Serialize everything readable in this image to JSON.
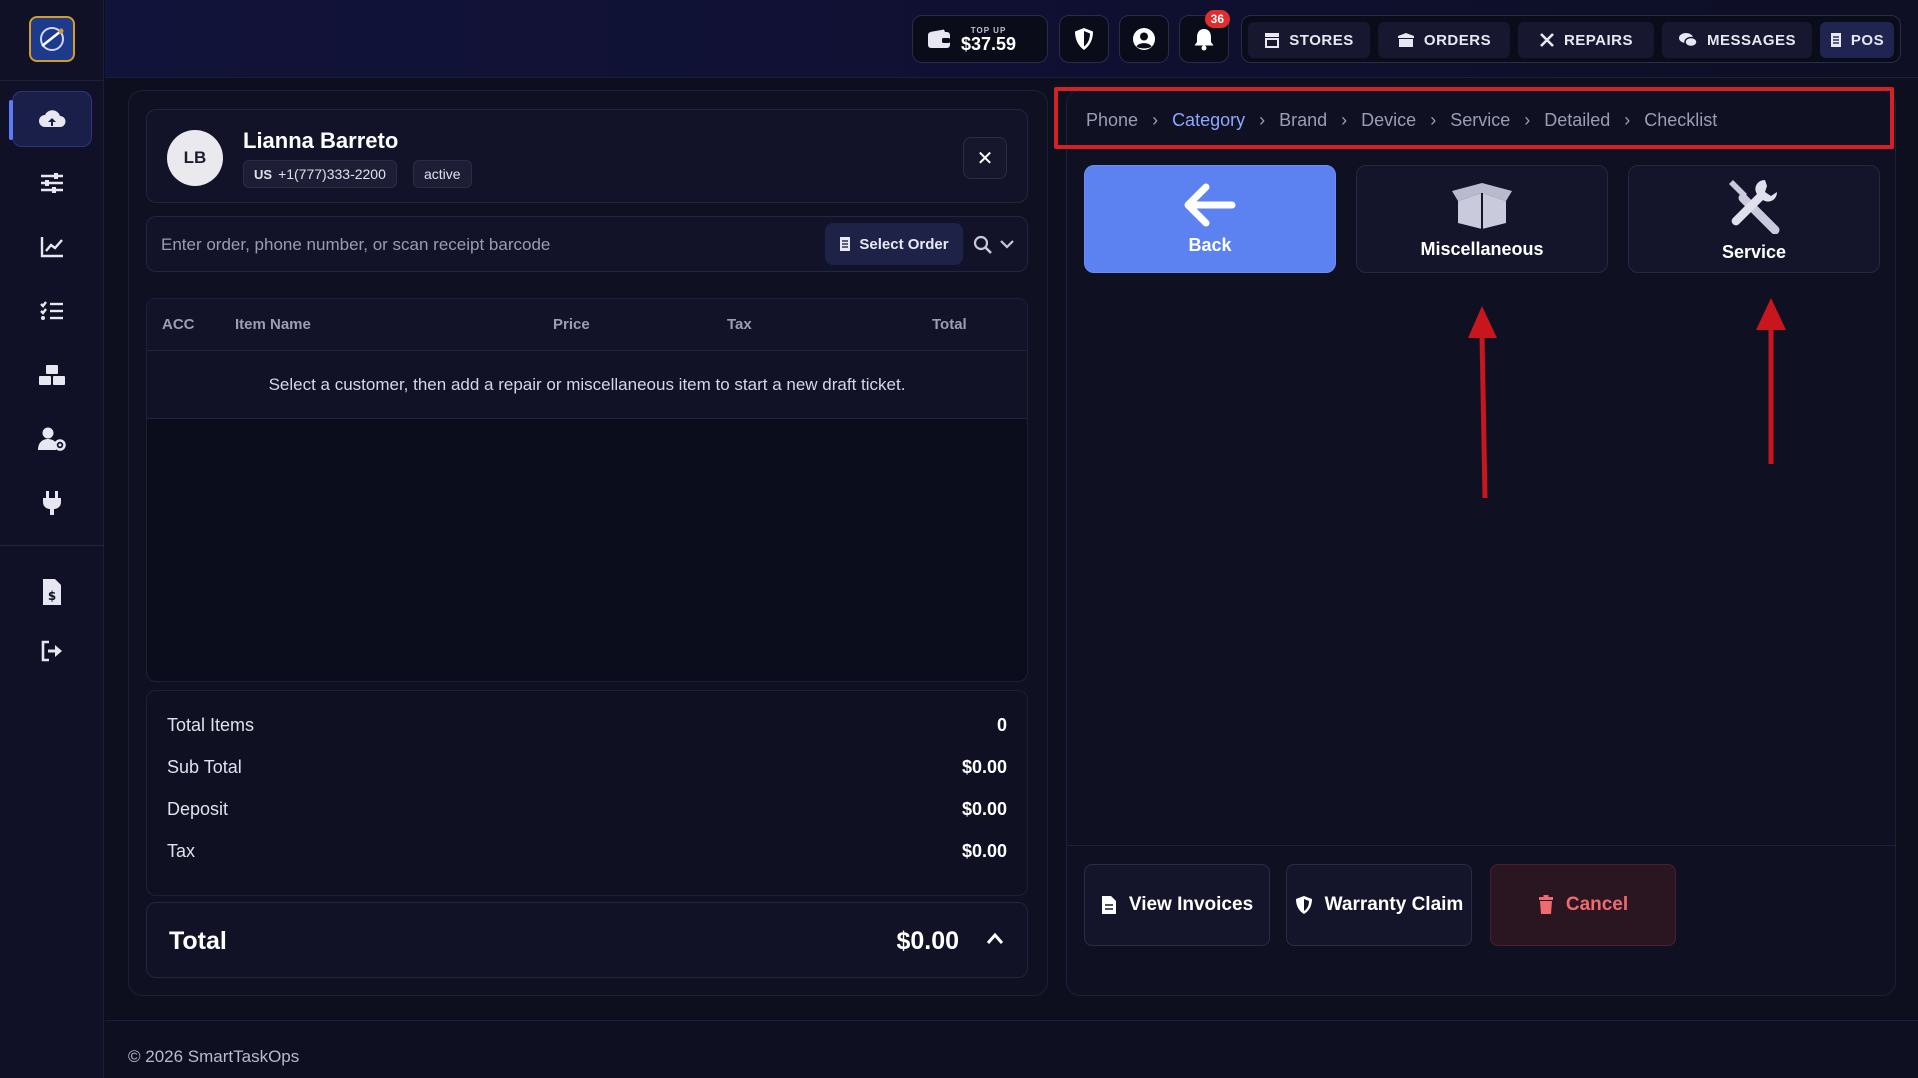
{
  "topbar": {
    "wallet_topup": "TOP UP",
    "wallet_amount": "$37.59",
    "notification_count": "36",
    "nav": [
      "STORES",
      "ORDERS",
      "REPAIRS",
      "MESSAGES",
      "POS"
    ]
  },
  "customer": {
    "initials": "LB",
    "name": "Lianna Barreto",
    "country": "US",
    "phone": "+1(777)333-2200",
    "status": "active"
  },
  "search": {
    "placeholder": "Enter order, phone number, or scan receipt barcode",
    "select_order_label": "Select Order"
  },
  "table": {
    "headers": [
      "ACC",
      "Item Name",
      "Price",
      "Tax",
      "Total"
    ],
    "empty_message": "Select a customer, then add a repair or miscellaneous item to start a new draft ticket."
  },
  "totals": {
    "rows": [
      {
        "label": "Total Items",
        "value": "0"
      },
      {
        "label": "Sub Total",
        "value": "$0.00"
      },
      {
        "label": "Deposit",
        "value": "$0.00"
      },
      {
        "label": "Tax",
        "value": "$0.00"
      }
    ],
    "grand_label": "Total",
    "grand_value": "$0.00"
  },
  "breadcrumb": [
    "Phone",
    "Category",
    "Brand",
    "Device",
    "Service",
    "Detailed",
    "Checklist"
  ],
  "breadcrumb_current": "Category",
  "categories": [
    {
      "label": "Back",
      "icon": "arrow-left-icon"
    },
    {
      "label": "Miscellaneous",
      "icon": "box-open-icon"
    },
    {
      "label": "Service",
      "icon": "tools-icon"
    }
  ],
  "actions": [
    {
      "label": "View Invoices",
      "icon": "file-icon"
    },
    {
      "label": "Warranty Claim",
      "icon": "shield-icon"
    },
    {
      "label": "Cancel",
      "icon": "trash-icon"
    }
  ],
  "footer": "© 2026 SmartTaskOps",
  "colors": {
    "accent": "#5b82f0",
    "annotation_red": "#d42027",
    "danger": "#f06a72",
    "badge": "#e02d2d"
  }
}
